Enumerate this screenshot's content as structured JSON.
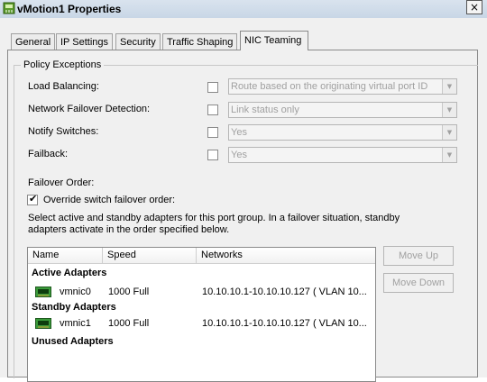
{
  "window": {
    "title": "vMotion1 Properties",
    "close_glyph": "×"
  },
  "tabs": [
    {
      "label": "General"
    },
    {
      "label": "IP Settings"
    },
    {
      "label": "Security"
    },
    {
      "label": "Traffic Shaping"
    },
    {
      "label": "NIC Teaming",
      "active": true
    }
  ],
  "policy": {
    "group_title": "Policy Exceptions",
    "rows": [
      {
        "label": "Load Balancing:",
        "checked": false,
        "value": "Route based on the originating virtual port ID"
      },
      {
        "label": "Network Failover Detection:",
        "checked": false,
        "value": "Link status only"
      },
      {
        "label": "Notify Switches:",
        "checked": false,
        "value": "Yes"
      },
      {
        "label": "Failback:",
        "checked": false,
        "value": "Yes"
      }
    ]
  },
  "failover": {
    "heading": "Failover Order:",
    "override_label": "Override switch failover order:",
    "override_checked": true,
    "description_line1": "Select active and standby adapters for this port group.  In a failover situation, standby",
    "description_line2": "adapters activate  in the order specified below."
  },
  "adapter_list": {
    "columns": [
      "Name",
      "Speed",
      "Networks"
    ],
    "groups": [
      {
        "label": "Active Adapters",
        "rows": [
          {
            "name": "vmnic0",
            "speed": "1000 Full",
            "networks": "10.10.10.1-10.10.10.127 ( VLAN 10..."
          }
        ]
      },
      {
        "label": "Standby Adapters",
        "rows": [
          {
            "name": "vmnic1",
            "speed": "1000 Full",
            "networks": "10.10.10.1-10.10.10.127 ( VLAN 10..."
          }
        ]
      },
      {
        "label": "Unused Adapters",
        "rows": []
      }
    ]
  },
  "buttons": {
    "move_up": "Move Up",
    "move_down": "Move Down"
  },
  "colors": {
    "title_bar": "#c8d6e6",
    "nic_green": "#2e8b2e",
    "disabled_text": "#a0a0a0"
  }
}
